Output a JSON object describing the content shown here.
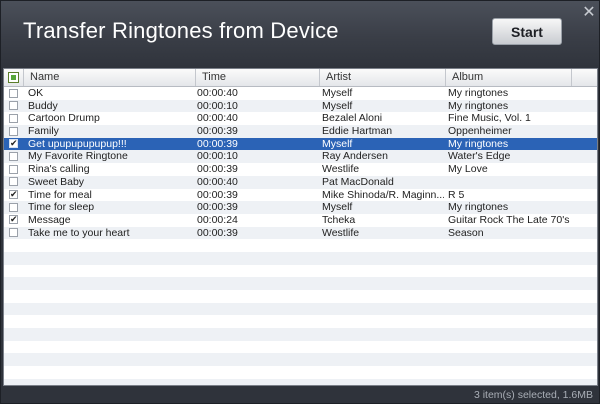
{
  "window": {
    "title": "Transfer Ringtones from Device",
    "start_label": "Start",
    "close_glyph": "✕"
  },
  "columns": [
    "Name",
    "Time",
    "Artist",
    "Album"
  ],
  "rows": [
    {
      "checked": false,
      "name": "OK",
      "time": "00:00:40",
      "artist": "Myself",
      "album": "My ringtones"
    },
    {
      "checked": false,
      "name": "Buddy",
      "time": "00:00:10",
      "artist": "Myself",
      "album": "My ringtones"
    },
    {
      "checked": false,
      "name": "Cartoon Drump",
      "time": "00:00:40",
      "artist": "Bezalel Aloni",
      "album": "Fine Music, Vol. 1"
    },
    {
      "checked": false,
      "name": "Family",
      "time": "00:00:39",
      "artist": "Eddie Hartman",
      "album": "Oppenheimer"
    },
    {
      "checked": true,
      "name": "Get upupupupupup!!!",
      "time": "00:00:39",
      "artist": "Myself",
      "album": "My ringtones",
      "selected": true
    },
    {
      "checked": false,
      "name": "My Favorite Ringtone",
      "time": "00:00:10",
      "artist": "Ray Andersen",
      "album": "Water's Edge"
    },
    {
      "checked": false,
      "name": "Rina's calling",
      "time": "00:00:39",
      "artist": "Westlife",
      "album": "My Love"
    },
    {
      "checked": false,
      "name": "Sweet Baby",
      "time": "00:00:40",
      "artist": "Pat MacDonald",
      "album": ""
    },
    {
      "checked": true,
      "name": "Time for meal",
      "time": "00:00:39",
      "artist": "Mike Shinoda/R. Maginn...",
      "album": "R 5"
    },
    {
      "checked": false,
      "name": "Time for sleep",
      "time": "00:00:39",
      "artist": "Myself",
      "album": "My ringtones"
    },
    {
      "checked": true,
      "name": "Message",
      "time": "00:00:24",
      "artist": "Tcheka",
      "album": "Guitar Rock The Late 70's"
    },
    {
      "checked": false,
      "name": "Take me to your heart",
      "time": "00:00:39",
      "artist": "Westlife",
      "album": "Season"
    }
  ],
  "status": {
    "text": "3 item(s) selected, 1.6MB"
  },
  "colors": {
    "selection": "#2b63b6",
    "header_checkbox": "#58a73a"
  }
}
